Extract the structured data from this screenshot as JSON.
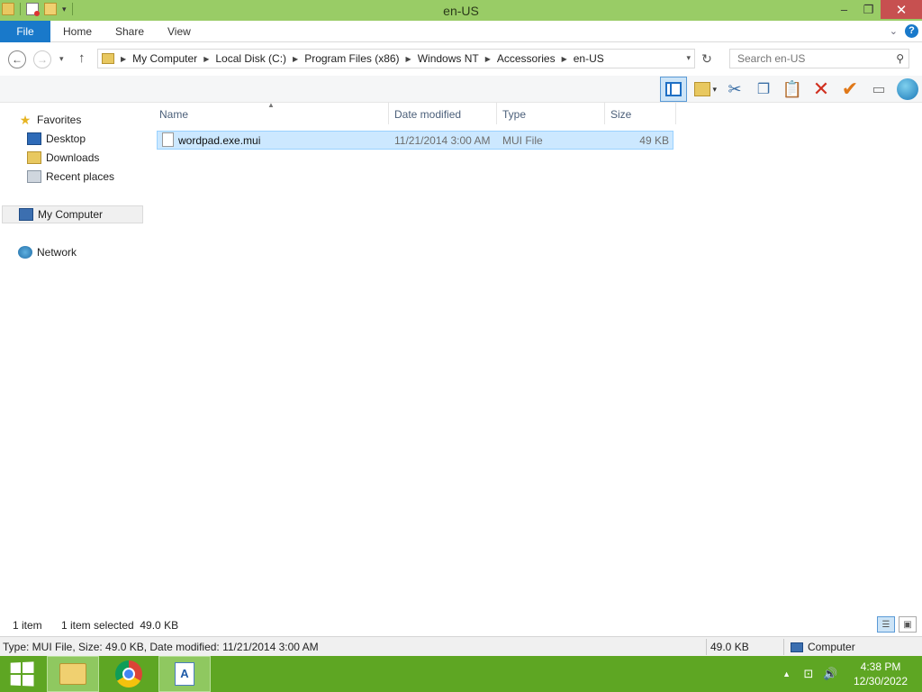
{
  "window": {
    "title": "en-US"
  },
  "ribbon": {
    "tabs": [
      {
        "label": "File"
      },
      {
        "label": "Home"
      },
      {
        "label": "Share"
      },
      {
        "label": "View"
      }
    ],
    "help_label": "?"
  },
  "address": {
    "breadcrumbs": [
      "My Computer",
      "Local Disk (C:)",
      "Program Files (x86)",
      "Windows NT",
      "Accessories",
      "en-US"
    ]
  },
  "search": {
    "placeholder": "Search en-US"
  },
  "navpane": {
    "favorites": "Favorites",
    "desktop": "Desktop",
    "downloads": "Downloads",
    "recent": "Recent places",
    "computer": "My Computer",
    "network": "Network"
  },
  "columns": {
    "name": "Name",
    "date": "Date modified",
    "type": "Type",
    "size": "Size"
  },
  "files": [
    {
      "name": "wordpad.exe.mui",
      "date": "11/21/2014 3:00 AM",
      "type": "MUI File",
      "size": "49 KB",
      "selected": true
    }
  ],
  "status": {
    "item_count": "1 item",
    "selection": "1 item selected  49.0 KB"
  },
  "details": {
    "summary": "Type: MUI File, Size: 49.0 KB, Date modified: 11/21/2014 3:00 AM",
    "size": "49.0 KB",
    "location": "Computer"
  },
  "taskbar": {
    "time": "4:38 PM",
    "date": "12/30/2022"
  },
  "colors": {
    "titlebar": "#99cc66",
    "file_tab": "#1979ca",
    "taskbar": "#5ea623",
    "selection": "#cce8ff",
    "close_button": "#c75050"
  },
  "icons": {
    "toolbar": [
      "preview-pane-icon",
      "folder-options-icon",
      "cut-icon",
      "copy-icon",
      "paste-icon",
      "delete-icon",
      "checkmark-icon",
      "rename-icon",
      "globe-icon"
    ]
  }
}
